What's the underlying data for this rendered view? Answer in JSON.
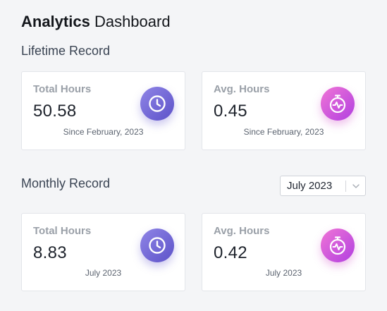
{
  "header": {
    "title_bold": "Analytics",
    "title_rest": "Dashboard"
  },
  "lifetime": {
    "heading": "Lifetime Record",
    "total": {
      "label": "Total Hours",
      "value": "50.58",
      "foot": "Since February, 2023",
      "icon": "clock-icon"
    },
    "avg": {
      "label": "Avg. Hours",
      "value": "0.45",
      "foot": "Since February, 2023",
      "icon": "stopwatch-icon"
    }
  },
  "monthly": {
    "heading": "Monthly Record",
    "selected_month": "July 2023",
    "total": {
      "label": "Total Hours",
      "value": "8.83",
      "foot": "July 2023",
      "icon": "clock-icon"
    },
    "avg": {
      "label": "Avg. Hours",
      "value": "0.42",
      "foot": "July 2023",
      "icon": "stopwatch-icon"
    }
  },
  "colors": {
    "purple_badge": "#6b60d6",
    "pink_badge": "#d652dc"
  }
}
